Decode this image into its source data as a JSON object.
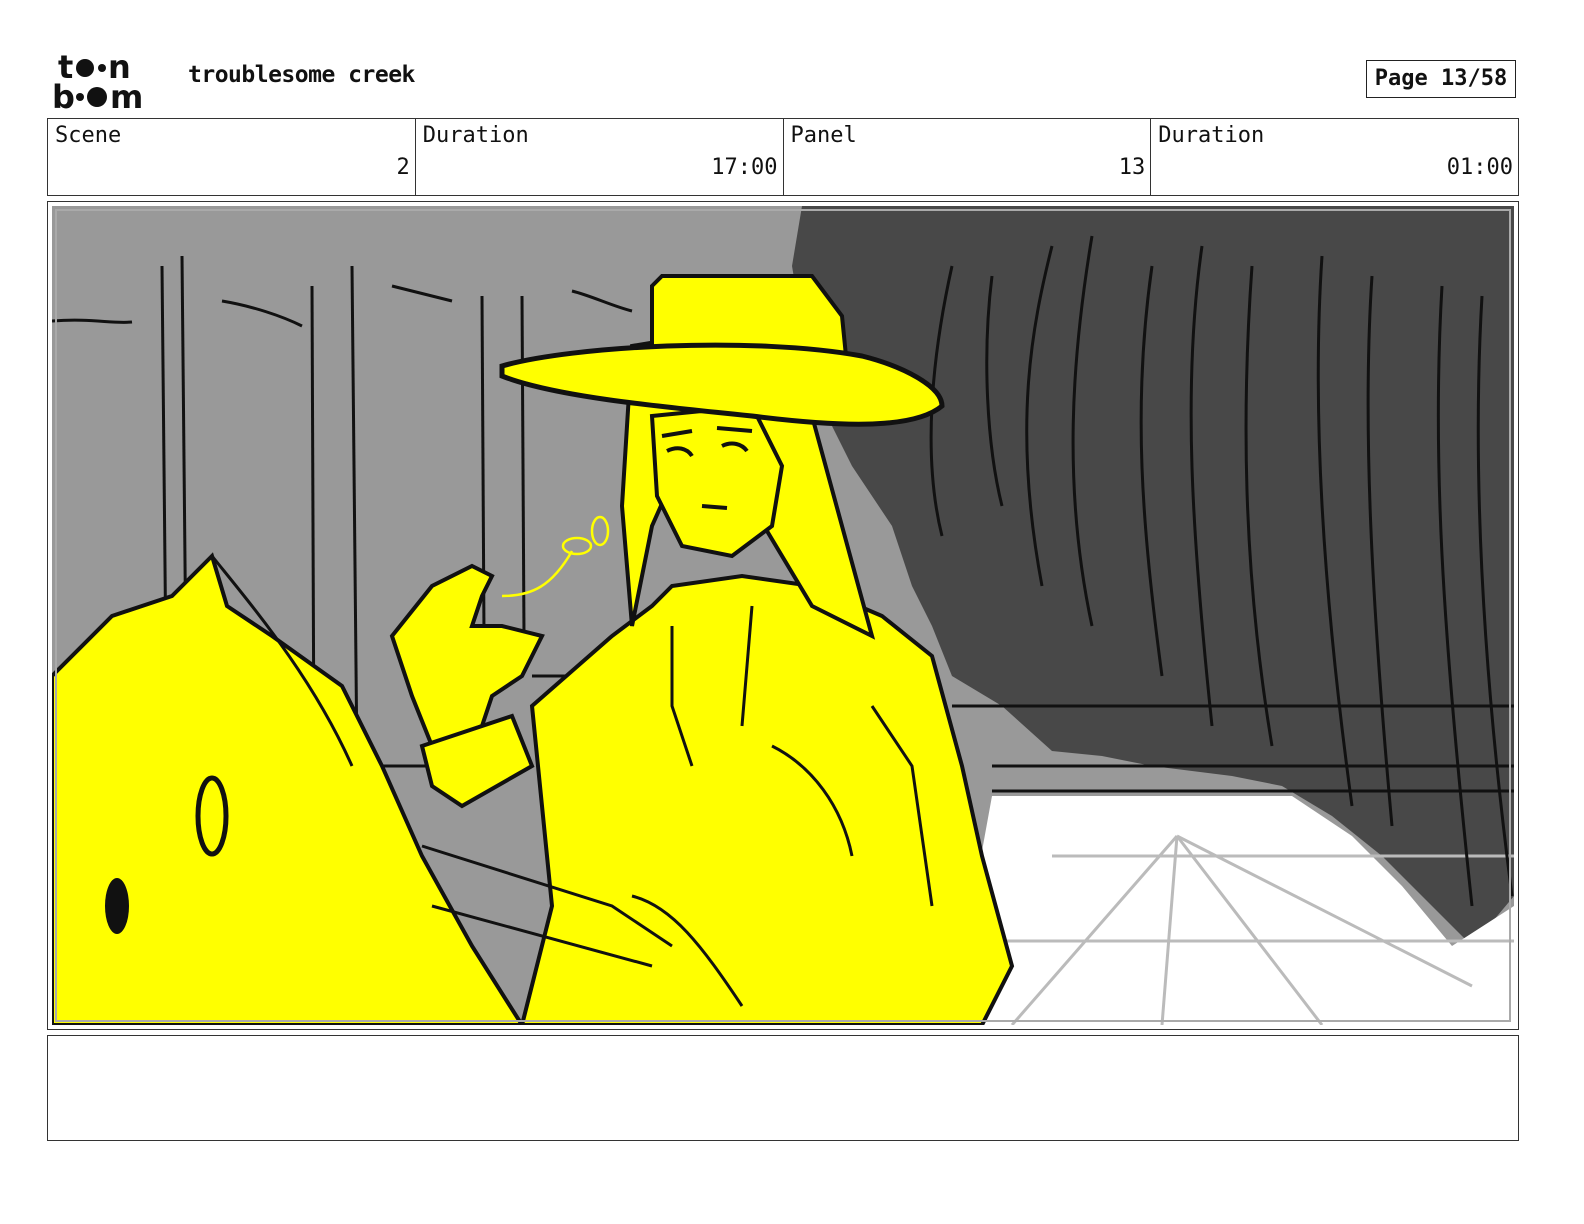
{
  "header": {
    "logo_text": "toon boom",
    "project_title": "troublesome creek",
    "page_label": "Page 13/58"
  },
  "info": {
    "scene_label": "Scene",
    "scene_value": "2",
    "scene_duration_label": "Duration",
    "scene_duration_value": "17:00",
    "panel_label": "Panel",
    "panel_value": "13",
    "panel_duration_label": "Duration",
    "panel_duration_value": "01:00"
  },
  "panel": {
    "colors": {
      "highlight": "#ffff00",
      "background": "#999999",
      "shadow": "#484848",
      "floor": "#ffffff"
    }
  },
  "notes": {
    "text": ""
  }
}
